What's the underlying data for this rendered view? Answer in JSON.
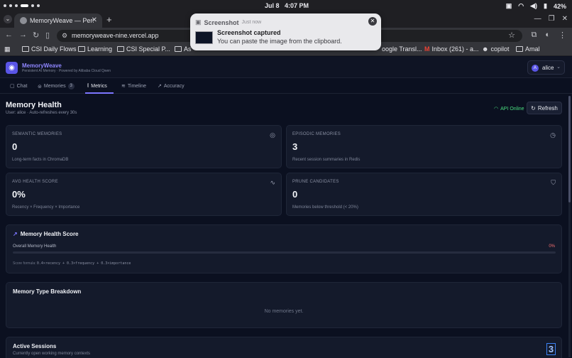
{
  "statusbar": {
    "date": "Jul 8",
    "time": "4:07 PM",
    "battery": "42%"
  },
  "browser": {
    "tab_title": "MemoryWeave — Pers",
    "url": "memoryweave-nine.vercel.app",
    "bookmarks": [
      "CSI Daily Flows",
      "Learning",
      "CSI Special P...",
      "As",
      "oogle Transl...",
      "Inbox (261) - a...",
      "copilot",
      "Amal"
    ]
  },
  "toast": {
    "app": "Screenshot",
    "time": "Just now",
    "title": "Screenshot captured",
    "body": "You can paste the image from the clipboard."
  },
  "app": {
    "name": "MemoryWeave",
    "subtitle": "Persistent AI Memory · Powered by Alibaba Cloud Qwen",
    "user_initial": "A",
    "user": "alice"
  },
  "tabs": [
    {
      "label": "Chat"
    },
    {
      "label": "Memories",
      "badge": "3"
    },
    {
      "label": "Metrics"
    },
    {
      "label": "Timeline"
    },
    {
      "label": "Accuracy"
    }
  ],
  "page": {
    "title": "Memory Health",
    "subtitle": "User: alice · Auto-refreshes every 30s",
    "api_status": "API Online",
    "refresh_label": "Refresh"
  },
  "cards": [
    {
      "label": "SEMANTIC MEMORIES",
      "value": "0",
      "desc": "Long-term facts in ChromaDB",
      "icon": "brain-icon"
    },
    {
      "label": "EPISODIC MEMORIES",
      "value": "3",
      "desc": "Recent session summaries in Redis",
      "icon": "clock-icon"
    },
    {
      "label": "AVG HEALTH SCORE",
      "value": "0%",
      "desc": "Recency × Frequency × Importance",
      "icon": "activity-icon"
    },
    {
      "label": "PRUNE CANDIDATES",
      "value": "0",
      "desc": "Memories below threshold (< 20%)",
      "icon": "shield-icon"
    }
  ],
  "health": {
    "title": "Memory Health Score",
    "overall_label": "Overall Memory Health",
    "overall_value": "0%",
    "overall_fraction": 0,
    "formula_label": "Score formula:",
    "formula": "0.4×recency + 0.3×frequency + 0.3×importance"
  },
  "breakdown": {
    "title": "Memory Type Breakdown",
    "empty": "No memories yet."
  },
  "sessions": {
    "title": "Active Sessions",
    "subtitle": "Currently open working memory contexts",
    "count": "3"
  }
}
